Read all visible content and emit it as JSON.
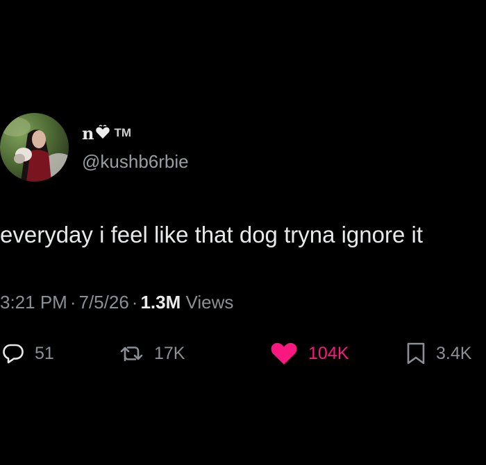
{
  "tweet": {
    "display_name_glyphs": "n",
    "display_name_tm": "TM",
    "handle": "@kushb6rbie",
    "text": "everyday i feel like that dog tryna ignore it",
    "time": "3:21 PM",
    "date": "7/5/26",
    "views_count": "1.3M",
    "views_label": "Views",
    "separator": "·"
  },
  "actions": {
    "reply_count": "51",
    "retweet_count": "17K",
    "like_count": "104K",
    "bookmark_count": "3.4K"
  },
  "colors": {
    "background": "#000000",
    "like_pink": "#f91880",
    "muted_gray": "#8b9095"
  },
  "icons": {
    "avatar": "profile-photo",
    "name_heart": "heart-emoji-icon",
    "reply": "reply-bubble-icon",
    "retweet": "retweet-arrows-icon",
    "like": "heart-filled-icon",
    "bookmark": "bookmark-icon"
  }
}
